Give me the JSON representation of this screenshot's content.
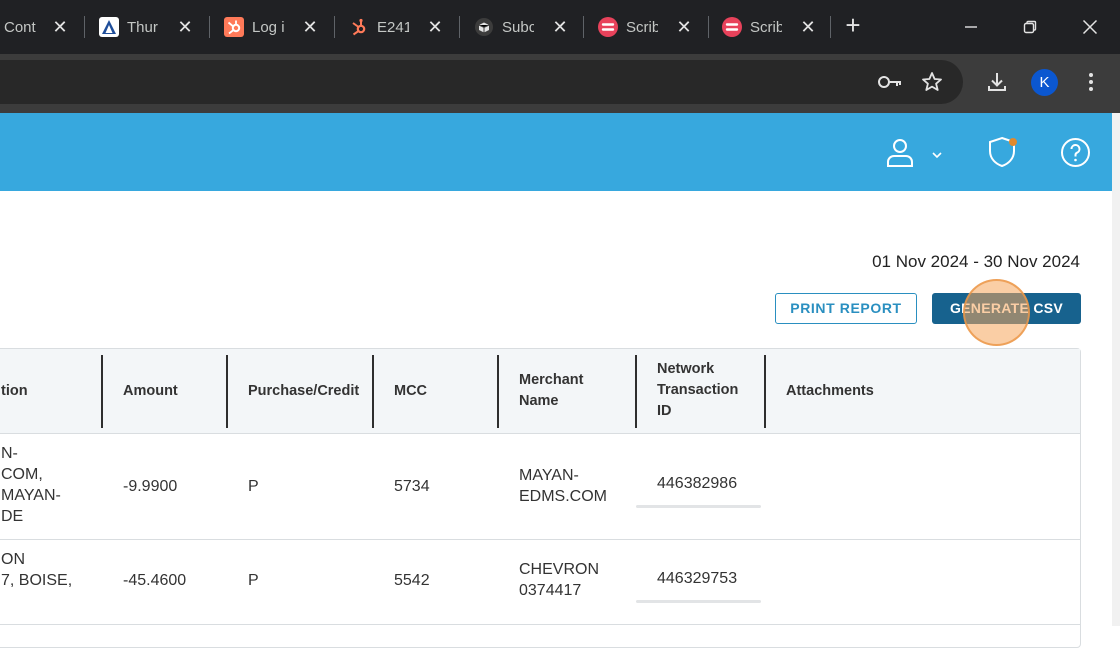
{
  "browser": {
    "tabs": [
      {
        "title": "Cont",
        "favicon": "generic-page-icon"
      },
      {
        "title": "Thur",
        "favicon": "triangle-logo-icon"
      },
      {
        "title": "Log i",
        "favicon": "hubspot-icon"
      },
      {
        "title": "E241",
        "favicon": "hubspot-sprocket-icon"
      },
      {
        "title": "Subc",
        "favicon": "box-logo-icon"
      },
      {
        "title": "Scrib",
        "favicon": "scribe-icon"
      },
      {
        "title": "Scrib",
        "favicon": "scribe-icon"
      }
    ],
    "profile_initial": "K"
  },
  "report": {
    "date_range": "01 Nov 2024 - 30 Nov 2024",
    "print_label": "PRINT REPORT",
    "csv_label": "GENERATE CSV"
  },
  "table": {
    "headers": {
      "description": "tion",
      "amount": "Amount",
      "purchase_credit": "Purchase/Credit",
      "mcc": "MCC",
      "merchant_name": "Merchant Name",
      "network_transaction_id": "Network Transaction ID",
      "attachments": "Attachments"
    },
    "rows": [
      {
        "description": "N-\nCOM,\nMAYAN-\nDE",
        "amount": "-9.9900",
        "purchase_credit": "P",
        "mcc": "5734",
        "merchant_name": "MAYAN-\nEDMS.COM",
        "network_transaction_id": "446382986"
      },
      {
        "description": "ON\n7, BOISE,",
        "amount": "-45.4600",
        "purchase_credit": "P",
        "mcc": "5542",
        "merchant_name": "CHEVRON\n0374417",
        "network_transaction_id": "446329753"
      }
    ]
  },
  "colors": {
    "header_blue": "#37a8de",
    "primary_button": "#17628e",
    "outline_button": "#2a8fc0",
    "notification_dot": "#e08a2e"
  }
}
